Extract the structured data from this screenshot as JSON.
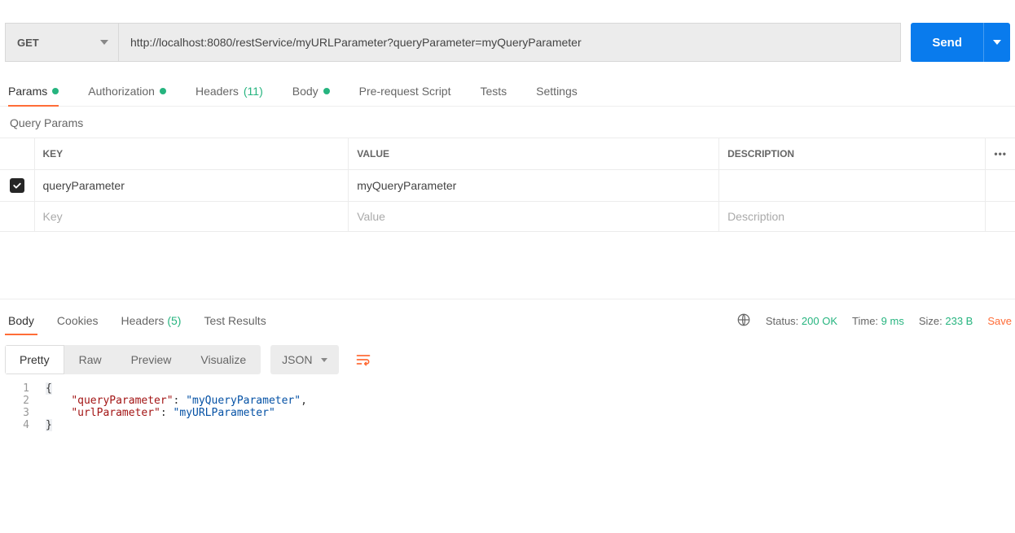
{
  "request": {
    "method": "GET",
    "url": "http://localhost:8080/restService/myURLParameter?queryParameter=myQueryParameter",
    "send_label": "Send"
  },
  "tabs": {
    "params": "Params",
    "auth": "Authorization",
    "headers": "Headers",
    "headers_count": "(11)",
    "body": "Body",
    "prescript": "Pre-request Script",
    "tests": "Tests",
    "settings": "Settings"
  },
  "section": {
    "query_params": "Query Params"
  },
  "params_table": {
    "h_key": "KEY",
    "h_value": "VALUE",
    "h_desc": "DESCRIPTION",
    "rows": [
      {
        "checked": true,
        "key": "queryParameter",
        "value": "myQueryParameter",
        "desc": ""
      }
    ],
    "ph_key": "Key",
    "ph_value": "Value",
    "ph_desc": "Description"
  },
  "resp_tabs": {
    "body": "Body",
    "cookies": "Cookies",
    "headers": "Headers",
    "headers_count": "(5)",
    "tests": "Test Results"
  },
  "resp_meta": {
    "status_lbl": "Status:",
    "status_val": "200 OK",
    "time_lbl": "Time:",
    "time_val": "9 ms",
    "size_lbl": "Size:",
    "size_val": "233 B",
    "save": "Save"
  },
  "body_toolbar": {
    "pretty": "Pretty",
    "raw": "Raw",
    "preview": "Preview",
    "visualize": "Visualize",
    "json": "JSON"
  },
  "response_body": {
    "l1": "{",
    "l2_key": "\"queryParameter\"",
    "l2_val": "\"myQueryParameter\"",
    "l3_key": "\"urlParameter\"",
    "l3_val": "\"myURLParameter\"",
    "l4": "}"
  }
}
